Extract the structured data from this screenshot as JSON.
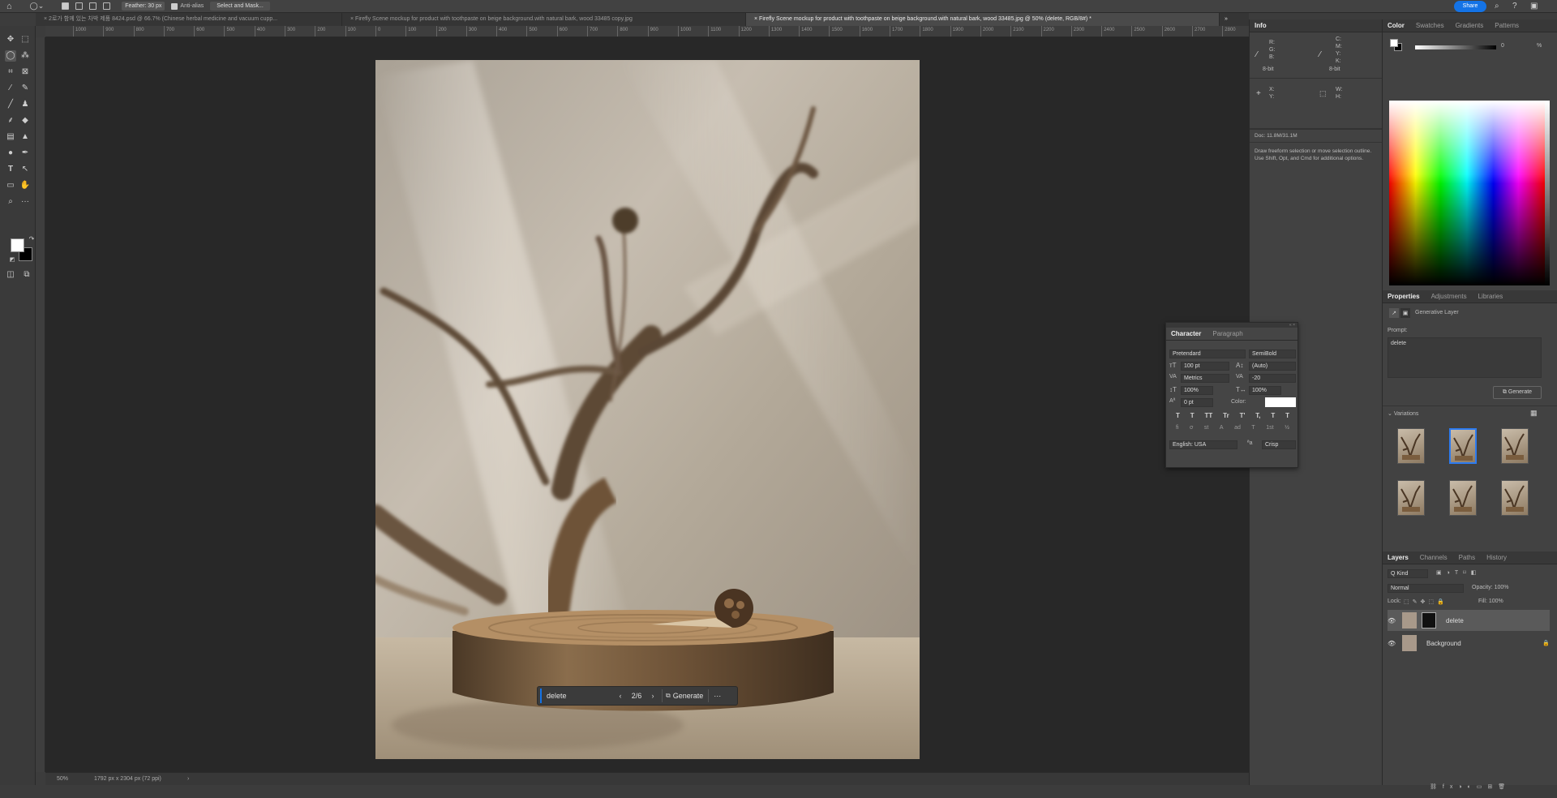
{
  "options_bar": {
    "feather": "Feather: 30 px",
    "anti_alias": "Anti-alias",
    "select_mask": "Select and Mask...",
    "share": "Share"
  },
  "tabs": [
    {
      "label": "2로가 함께 있는 차박 제품 8424.psd @ 66.7% (Chinese herbal medicine and vacuum cupp..."
    },
    {
      "label": "Firefly Scene mockup for product with toothpaste on beige background.with natural bark, wood 33485 copy.jpg"
    },
    {
      "label": "Firefly Scene mockup for product with toothpaste on beige background.with natural bark, wood 33485.jpg @ 50% (delete, RGB/8#) *"
    }
  ],
  "ruler": [
    "1000",
    "900",
    "800",
    "700",
    "600",
    "500",
    "400",
    "300",
    "200",
    "100",
    "0",
    "100",
    "200",
    "300",
    "400",
    "500",
    "600",
    "700",
    "800",
    "900",
    "1000",
    "1100",
    "1200",
    "1300",
    "1400",
    "1500",
    "1600",
    "1700",
    "1800",
    "1900",
    "2000",
    "2100",
    "2200",
    "2300",
    "2400",
    "2500",
    "2600",
    "2700",
    "2800"
  ],
  "context_bar": {
    "prompt": "delete",
    "counter": "2/6",
    "generate": "Generate",
    "more": "···"
  },
  "status": {
    "zoom": "50%",
    "doc": "1792 px x 2304 px (72 ppi)"
  },
  "info": {
    "tab": "Info",
    "rgb": [
      "R:",
      "G:",
      "B:"
    ],
    "cmyk": [
      "C:",
      "M:",
      "Y:",
      "K:"
    ],
    "bit1": "8-bit",
    "bit2": "8-bit",
    "xy": [
      "X:",
      "Y:"
    ],
    "wh": [
      "W:",
      "H:"
    ],
    "doc": "Doc: 11.8M/31.1M",
    "hint": "Draw freeform selection or move selection outline.  Use Shift, Opt, and Cmd for additional options."
  },
  "character": {
    "tabs": [
      "Character",
      "Paragraph"
    ],
    "font": "Pretendard",
    "style": "SemiBold",
    "size": "100 pt",
    "leading": "(Auto)",
    "kerning": "Metrics",
    "tracking": "-20",
    "vscale": "100%",
    "hscale": "100%",
    "baseline": "0 pt",
    "color_label": "Color:",
    "language": "English: USA",
    "aa": "Crisp",
    "typo": [
      "T",
      "T",
      "TT",
      "Tr",
      "T'",
      "T,",
      "T",
      "T"
    ],
    "ot": [
      "fi",
      "σ",
      "st",
      "A",
      "ad",
      "T",
      "1st",
      "½"
    ]
  },
  "color_panel": {
    "tabs": [
      "Color",
      "Swatches",
      "Gradients",
      "Patterns"
    ],
    "hue_value": "0",
    "pct": "%"
  },
  "properties": {
    "tabs": [
      "Properties",
      "Adjustments",
      "Libraries"
    ],
    "layer_type": "Generative Layer",
    "prompt_label": "Prompt:",
    "prompt": "delete",
    "generate": "Generate",
    "variations": "Variations"
  },
  "layers": {
    "tabs": [
      "Layers",
      "Channels",
      "Paths",
      "History"
    ],
    "kind": "Q Kind",
    "blend": "Normal",
    "opacity": "Opacity: 100%",
    "lock": "Lock:",
    "fill": "Fill: 100%",
    "items": [
      {
        "name": "delete"
      },
      {
        "name": "Background"
      }
    ]
  },
  "colors": {
    "accent": "#1473e6",
    "panel": "#424242",
    "canvas": "#282828"
  }
}
